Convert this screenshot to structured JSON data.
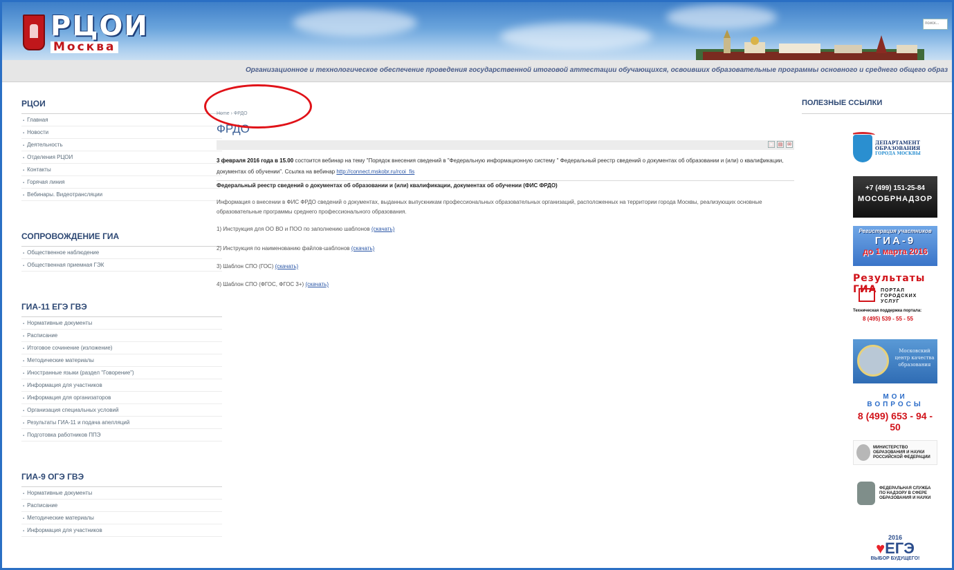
{
  "header": {
    "logo_main": "РЦОИ",
    "logo_sub": "Москва",
    "search_placeholder": "поиск..."
  },
  "tagline": "Организационное и технологическое обеспечение проведения государственной итоговой аттестации обучающихся, освоивших образовательные программы основного и среднего общего образ",
  "sidebar": {
    "sections": [
      {
        "title": "РЦОИ",
        "items": [
          "Главная",
          "Новости",
          "Деятельность",
          "Отделения РЦОИ",
          "Контакты",
          "Горячая линия",
          "Вебинары. Видеотрансляции"
        ]
      },
      {
        "title": "СОПРОВОЖДЕНИЕ ГИА",
        "items": [
          "Общественное наблюдение",
          "Общественная приемная ГЭК"
        ]
      },
      {
        "title": "ГИА-11 ЕГЭ ГВЭ",
        "items": [
          "Нормативные документы",
          "Расписание",
          "Итоговое сочинение (изложение)",
          "Методические материалы",
          "Иностранные языки (раздел \"Говорение\")",
          "Информация для участников",
          "Информация для организаторов",
          "Организация специальных условий",
          "Результаты ГИА-11 и подача апелляций",
          "Подготовка работников ППЭ"
        ]
      },
      {
        "title": "ГИА-9 ОГЭ ГВЭ",
        "items": [
          "Нормативные документы",
          "Расписание",
          "Методические материалы",
          "Информация для участников"
        ]
      }
    ]
  },
  "main": {
    "breadcrumb": "Home › ФРДО",
    "title": "ФРДО",
    "intro_bold": "3 февраля 2016 года в 15.00",
    "intro_text": " состоится вебинар на тему \"Порядок внесения сведений в \"Федеральную информационную систему \" Федеральный реестр сведений о документах об образовании и (или) о квалификации, документах об обучении\". Ссылка на вебинар ",
    "intro_link": "http://connect.mskobr.ru/rcoi_fis",
    "section_title": "Федеральный реестр сведений о документах об образовании и (или) квалификации, документах об обучении (ФИС ФРДО)",
    "section_desc": "Информация о внесении в ФИС ФРДО сведений о документах, выданных выпускникам профессиональных образовательных организаций, расположенных на территории города Москвы, реализующих основные образовательные программы среднего профессионального образования.",
    "downloads": [
      {
        "text": "1) Инструкция для ОО ВО и ПОО по заполнению шаблонов ",
        "link": "(скачать)"
      },
      {
        "text": "2) Инструкция по наименованию файлов-шаблонов ",
        "link": "(скачать)"
      },
      {
        "text": "3) Шаблон СПО (ГОС) ",
        "link": "(скачать)"
      },
      {
        "text": "4) Шаблон СПО (ФГОС, ФГОС 3+) ",
        "link": "(скачать)"
      }
    ]
  },
  "right": {
    "title": "ПОЛЕЗНЫЕ ССЫЛКИ",
    "b1": {
      "l1": "ДЕПАРТАМЕНТ",
      "l2": "ОБРАЗОВАНИЯ",
      "l3": "ГОРОДА МОСКВЫ"
    },
    "b2": {
      "phone": "+7 (499) 151-25-84",
      "name": "МОСОБРНАДЗОР"
    },
    "b3": {
      "l1": "Регистрация участников",
      "l2": "ГИА-9",
      "l3": "до 1 марта 2016"
    },
    "b4": {
      "h": "Результаты ГИА",
      "p1": "ПОРТАЛ",
      "p2": "ГОРОДСКИХ",
      "p3": "УСЛУГ",
      "support": "Техническая поддержка портала:",
      "phone": "8 (495) 539 - 55 - 55"
    },
    "b5": {
      "l1": "Московский",
      "l2": "центр качества",
      "l3": "образования"
    },
    "b6": {
      "a": "МОИ ВОПРОСЫ",
      "b": "8 (499) 653 - 94 - 50"
    },
    "b7": {
      "l1": "МИНИСТЕРСТВО",
      "l2": "ОБРАЗОВАНИЯ И НАУКИ",
      "l3": "РОССИЙСКОЙ ФЕДЕРАЦИИ"
    },
    "b8": {
      "l1": "ФЕДЕРАЛЬНАЯ СЛУЖБА",
      "l2": "ПО НАДЗОРУ В СФЕРЕ",
      "l3": "ОБРАЗОВАНИЯ И НАУКИ"
    },
    "b9": {
      "year": "2016",
      "e": "ЕГЭ",
      "slogan": "ВЫБОР БУДУЩЕГО!"
    }
  },
  "colors": {
    "frame": "#2a6fc4",
    "heading": "#2c4773",
    "title": "#3a5f96",
    "highlight_circle": "#e01218"
  }
}
